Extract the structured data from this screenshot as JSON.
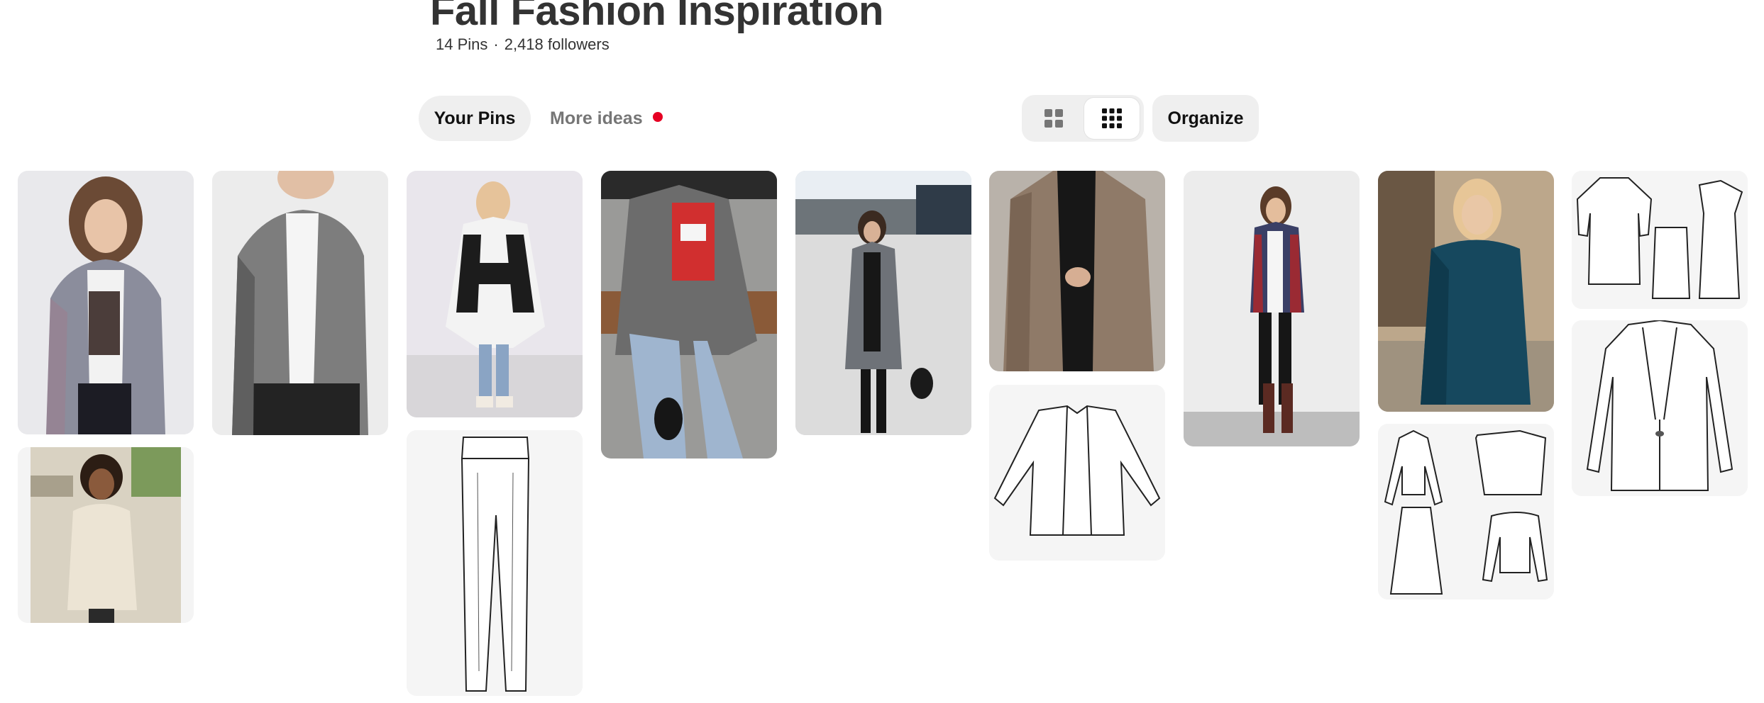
{
  "board": {
    "title": "Fall Fashion Inspiration",
    "pin_count": "14 Pins",
    "followers": "2,418 followers",
    "separator": "·"
  },
  "tabs": {
    "your_pins": "Your Pins",
    "more_ideas": "More ideas",
    "notification_color": "#e60023"
  },
  "toolbar": {
    "view_default_icon": "grid-2x2-icon",
    "view_compact_icon": "grid-3x3-icon",
    "selected_view": "compact",
    "organize": "Organize"
  },
  "pins": [
    {
      "id": "pin-1",
      "subject": "plaid-blazer-photo"
    },
    {
      "id": "pin-2",
      "subject": "grey-blazer-photo"
    },
    {
      "id": "pin-3",
      "subject": "plaid-poncho-photo"
    },
    {
      "id": "pin-4",
      "subject": "houndstooth-blazer-photo"
    },
    {
      "id": "pin-5",
      "subject": "street-blazer-photo"
    },
    {
      "id": "pin-6",
      "subject": "brown-check-blazer-photo"
    },
    {
      "id": "pin-7",
      "subject": "plaid-cardigan-photo"
    },
    {
      "id": "pin-8",
      "subject": "teal-coat-photo"
    },
    {
      "id": "pin-9",
      "subject": "dress-sketch"
    },
    {
      "id": "pin-10",
      "subject": "sweater-dress-photo"
    },
    {
      "id": "pin-11",
      "subject": "leggings-sketch"
    },
    {
      "id": "pin-12",
      "subject": "cardigan-sketch"
    },
    {
      "id": "pin-13",
      "subject": "outfit-set-sketch"
    },
    {
      "id": "pin-14",
      "subject": "jacket-sketch"
    }
  ]
}
